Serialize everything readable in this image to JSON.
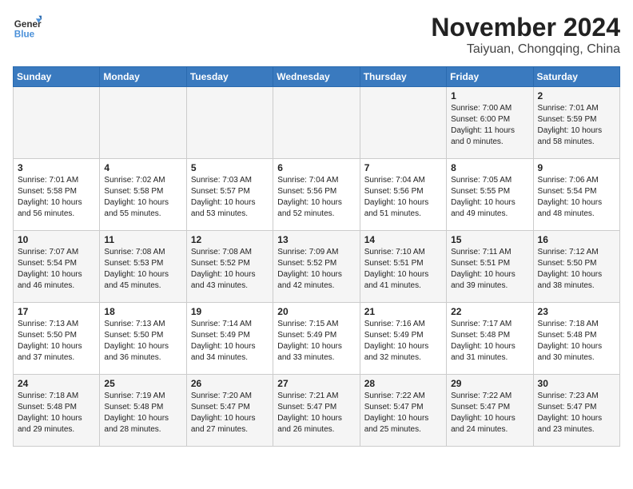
{
  "header": {
    "logo_general": "General",
    "logo_blue": "Blue",
    "month": "November 2024",
    "location": "Taiyuan, Chongqing, China"
  },
  "days_of_week": [
    "Sunday",
    "Monday",
    "Tuesday",
    "Wednesday",
    "Thursday",
    "Friday",
    "Saturday"
  ],
  "weeks": [
    [
      {
        "day": "",
        "info": ""
      },
      {
        "day": "",
        "info": ""
      },
      {
        "day": "",
        "info": ""
      },
      {
        "day": "",
        "info": ""
      },
      {
        "day": "",
        "info": ""
      },
      {
        "day": "1",
        "info": "Sunrise: 7:00 AM\nSunset: 6:00 PM\nDaylight: 11 hours and 0 minutes."
      },
      {
        "day": "2",
        "info": "Sunrise: 7:01 AM\nSunset: 5:59 PM\nDaylight: 10 hours and 58 minutes."
      }
    ],
    [
      {
        "day": "3",
        "info": "Sunrise: 7:01 AM\nSunset: 5:58 PM\nDaylight: 10 hours and 56 minutes."
      },
      {
        "day": "4",
        "info": "Sunrise: 7:02 AM\nSunset: 5:58 PM\nDaylight: 10 hours and 55 minutes."
      },
      {
        "day": "5",
        "info": "Sunrise: 7:03 AM\nSunset: 5:57 PM\nDaylight: 10 hours and 53 minutes."
      },
      {
        "day": "6",
        "info": "Sunrise: 7:04 AM\nSunset: 5:56 PM\nDaylight: 10 hours and 52 minutes."
      },
      {
        "day": "7",
        "info": "Sunrise: 7:04 AM\nSunset: 5:56 PM\nDaylight: 10 hours and 51 minutes."
      },
      {
        "day": "8",
        "info": "Sunrise: 7:05 AM\nSunset: 5:55 PM\nDaylight: 10 hours and 49 minutes."
      },
      {
        "day": "9",
        "info": "Sunrise: 7:06 AM\nSunset: 5:54 PM\nDaylight: 10 hours and 48 minutes."
      }
    ],
    [
      {
        "day": "10",
        "info": "Sunrise: 7:07 AM\nSunset: 5:54 PM\nDaylight: 10 hours and 46 minutes."
      },
      {
        "day": "11",
        "info": "Sunrise: 7:08 AM\nSunset: 5:53 PM\nDaylight: 10 hours and 45 minutes."
      },
      {
        "day": "12",
        "info": "Sunrise: 7:08 AM\nSunset: 5:52 PM\nDaylight: 10 hours and 43 minutes."
      },
      {
        "day": "13",
        "info": "Sunrise: 7:09 AM\nSunset: 5:52 PM\nDaylight: 10 hours and 42 minutes."
      },
      {
        "day": "14",
        "info": "Sunrise: 7:10 AM\nSunset: 5:51 PM\nDaylight: 10 hours and 41 minutes."
      },
      {
        "day": "15",
        "info": "Sunrise: 7:11 AM\nSunset: 5:51 PM\nDaylight: 10 hours and 39 minutes."
      },
      {
        "day": "16",
        "info": "Sunrise: 7:12 AM\nSunset: 5:50 PM\nDaylight: 10 hours and 38 minutes."
      }
    ],
    [
      {
        "day": "17",
        "info": "Sunrise: 7:13 AM\nSunset: 5:50 PM\nDaylight: 10 hours and 37 minutes."
      },
      {
        "day": "18",
        "info": "Sunrise: 7:13 AM\nSunset: 5:50 PM\nDaylight: 10 hours and 36 minutes."
      },
      {
        "day": "19",
        "info": "Sunrise: 7:14 AM\nSunset: 5:49 PM\nDaylight: 10 hours and 34 minutes."
      },
      {
        "day": "20",
        "info": "Sunrise: 7:15 AM\nSunset: 5:49 PM\nDaylight: 10 hours and 33 minutes."
      },
      {
        "day": "21",
        "info": "Sunrise: 7:16 AM\nSunset: 5:49 PM\nDaylight: 10 hours and 32 minutes."
      },
      {
        "day": "22",
        "info": "Sunrise: 7:17 AM\nSunset: 5:48 PM\nDaylight: 10 hours and 31 minutes."
      },
      {
        "day": "23",
        "info": "Sunrise: 7:18 AM\nSunset: 5:48 PM\nDaylight: 10 hours and 30 minutes."
      }
    ],
    [
      {
        "day": "24",
        "info": "Sunrise: 7:18 AM\nSunset: 5:48 PM\nDaylight: 10 hours and 29 minutes."
      },
      {
        "day": "25",
        "info": "Sunrise: 7:19 AM\nSunset: 5:48 PM\nDaylight: 10 hours and 28 minutes."
      },
      {
        "day": "26",
        "info": "Sunrise: 7:20 AM\nSunset: 5:47 PM\nDaylight: 10 hours and 27 minutes."
      },
      {
        "day": "27",
        "info": "Sunrise: 7:21 AM\nSunset: 5:47 PM\nDaylight: 10 hours and 26 minutes."
      },
      {
        "day": "28",
        "info": "Sunrise: 7:22 AM\nSunset: 5:47 PM\nDaylight: 10 hours and 25 minutes."
      },
      {
        "day": "29",
        "info": "Sunrise: 7:22 AM\nSunset: 5:47 PM\nDaylight: 10 hours and 24 minutes."
      },
      {
        "day": "30",
        "info": "Sunrise: 7:23 AM\nSunset: 5:47 PM\nDaylight: 10 hours and 23 minutes."
      }
    ]
  ]
}
